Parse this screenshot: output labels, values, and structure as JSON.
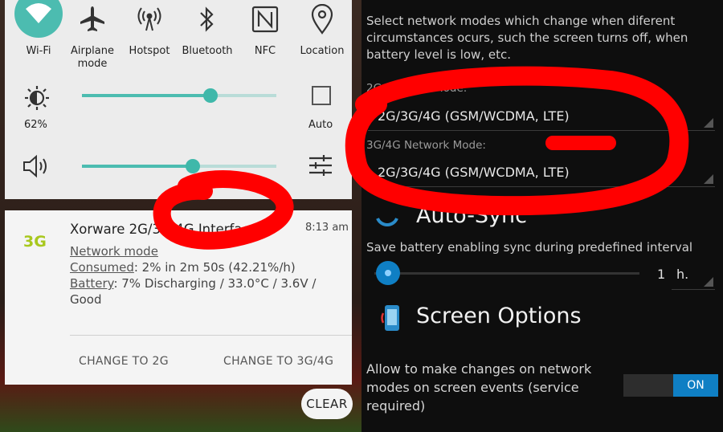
{
  "quick_settings": {
    "tiles": [
      {
        "label": "Wi-Fi",
        "icon": "wifi-icon"
      },
      {
        "label": "Airplane\nmode",
        "icon": "airplane-icon"
      },
      {
        "label": "Hotspot",
        "icon": "hotspot-icon"
      },
      {
        "label": "Bluetooth",
        "icon": "bluetooth-icon"
      },
      {
        "label": "NFC",
        "icon": "nfc-icon"
      },
      {
        "label": "Location",
        "icon": "location-icon"
      }
    ],
    "brightness": {
      "percent_label": "62%",
      "level": 0.66,
      "auto_label": "Auto"
    },
    "volume": {
      "level": 0.57
    }
  },
  "notification": {
    "badge": "3G",
    "title": "Xorware 2G/3G/4G Interface",
    "time": "8:13 am",
    "line1": "Network mode",
    "consumed_key": "Consumed",
    "consumed_value": ": 2% in 2m 50s (42.21%/h)",
    "battery_key": "Battery",
    "battery_value": ": 7% Discharging / 33.0°C / 3.6V /",
    "battery_value2": "Good",
    "action1": "CHANGE TO 2G",
    "action2": "CHANGE TO 3G/4G",
    "clear_label": "CLEAR"
  },
  "settings": {
    "intro_line1": "Select network modes which change when diferent",
    "intro_line2": "circumstances ocurs, such the screen turns off, when",
    "intro_line3": "battery level is low, etc.",
    "mode1_label": "2G Network Mode:",
    "mode1_value": "2G/3G/4G (GSM/WCDMA, LTE)",
    "mode2_label": "3G/4G Network Mode:",
    "mode2_value": "2G/3G/4G (GSM/WCDMA, LTE)",
    "autosync_title": "Auto-Sync",
    "autosync_desc": "Save battery enabling sync during predefined interval",
    "interval_value": "1",
    "interval_unit": "h.",
    "screen_title": "Screen Options",
    "screen_desc1": "Allow to make changes on network",
    "screen_desc2": "modes on screen events (service",
    "screen_desc3": "required)",
    "toggle_label": "ON"
  },
  "colors": {
    "accent": "#4cbcb0",
    "badge": "#a8c81e",
    "annotation": "#ff0000",
    "toggle_on": "#0f7fc4"
  }
}
